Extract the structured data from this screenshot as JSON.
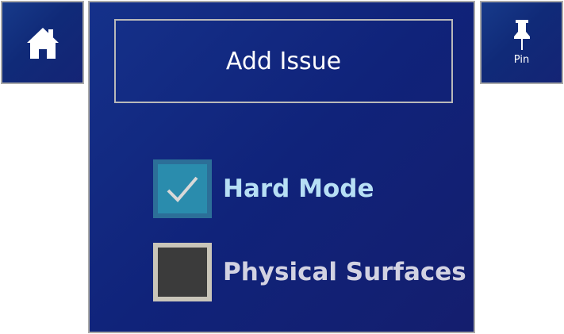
{
  "home": {
    "icon": "home-icon"
  },
  "pin": {
    "icon": "pin-icon",
    "label": "Pin"
  },
  "panel": {
    "add_issue_label": "Add Issue",
    "options": [
      {
        "label": "Hard Mode",
        "checked": true,
        "icon": "checkmark-icon"
      },
      {
        "label": "Physical Surfaces",
        "checked": false
      }
    ]
  },
  "colors": {
    "panel_blue": "#10237a",
    "checked_fill": "#2a8cad",
    "unchecked_fill": "#3b3b3b",
    "hard_mode_text": "#b7dff5",
    "physical_surfaces_text": "#d2d2e2"
  }
}
